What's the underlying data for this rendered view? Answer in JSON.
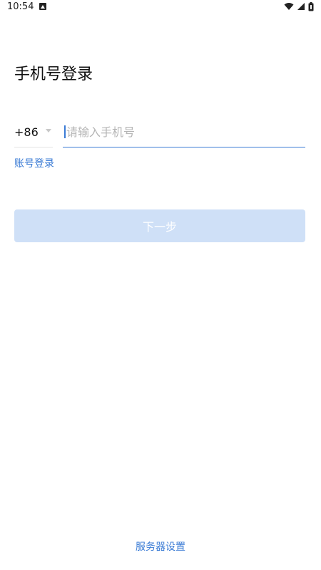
{
  "status_bar": {
    "time": "10:54",
    "icons": [
      "notification-icon",
      "wifi-icon",
      "cellular-signal-icon",
      "battery-icon"
    ]
  },
  "page": {
    "title": "手机号登录"
  },
  "phone_form": {
    "country_code": "+86",
    "phone_placeholder": "请输入手机号",
    "phone_value": ""
  },
  "links": {
    "account_login": "账号登录",
    "server_settings": "服务器设置"
  },
  "buttons": {
    "next_label": "下一步",
    "next_enabled": false
  },
  "colors": {
    "accent": "#3a7bd5",
    "button_disabled_bg": "#cfe0f7",
    "placeholder": "#b5b5b5"
  }
}
